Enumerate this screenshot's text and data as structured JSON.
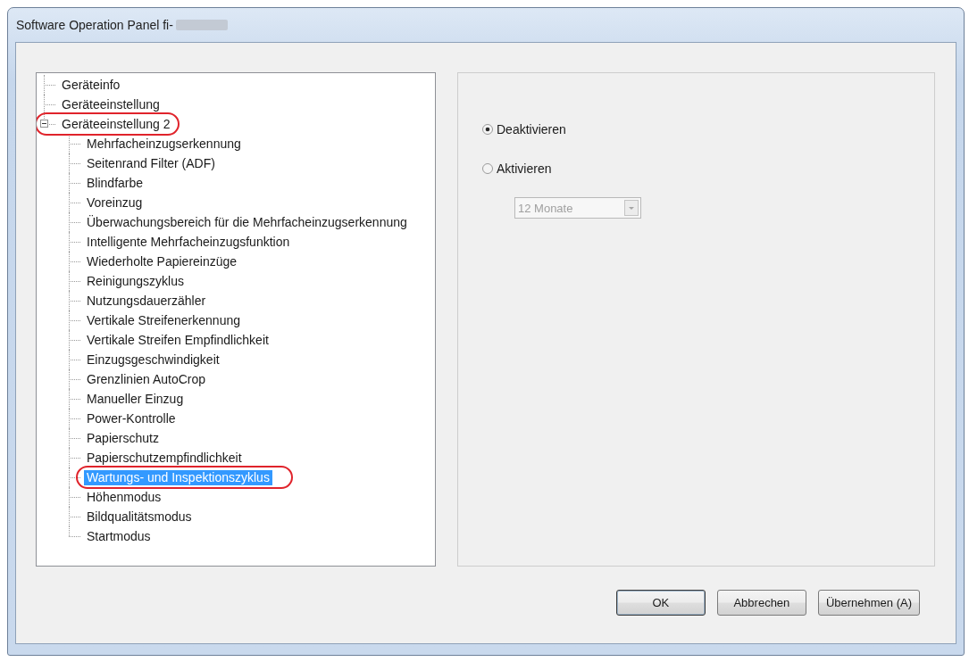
{
  "window": {
    "title": "Software Operation Panel fi-",
    "title_redacted": true
  },
  "tree": {
    "items": [
      {
        "label": "Geräteinfo",
        "selected": false,
        "circled": false
      },
      {
        "label": "Geräteeinstellung",
        "selected": false,
        "circled": false
      },
      {
        "label": "Geräteeinstellung 2",
        "selected": false,
        "circled": true,
        "expanded": true,
        "children": [
          {
            "label": "Mehrfacheinzugserkennung",
            "selected": false,
            "circled": false
          },
          {
            "label": "Seitenrand Filter (ADF)",
            "selected": false,
            "circled": false
          },
          {
            "label": "Blindfarbe",
            "selected": false,
            "circled": false
          },
          {
            "label": "Voreinzug",
            "selected": false,
            "circled": false
          },
          {
            "label": "Überwachungsbereich für die Mehrfacheinzugserkennung",
            "selected": false,
            "circled": false
          },
          {
            "label": "Intelligente Mehrfacheinzugsfunktion",
            "selected": false,
            "circled": false
          },
          {
            "label": "Wiederholte Papiereinzüge",
            "selected": false,
            "circled": false
          },
          {
            "label": "Reinigungszyklus",
            "selected": false,
            "circled": false
          },
          {
            "label": "Nutzungsdauerzähler",
            "selected": false,
            "circled": false
          },
          {
            "label": "Vertikale Streifenerkennung",
            "selected": false,
            "circled": false
          },
          {
            "label": "Vertikale Streifen Empfindlichkeit",
            "selected": false,
            "circled": false
          },
          {
            "label": "Einzugsgeschwindigkeit",
            "selected": false,
            "circled": false
          },
          {
            "label": "Grenzlinien AutoCrop",
            "selected": false,
            "circled": false
          },
          {
            "label": "Manueller Einzug",
            "selected": false,
            "circled": false
          },
          {
            "label": "Power-Kontrolle",
            "selected": false,
            "circled": false
          },
          {
            "label": "Papierschutz",
            "selected": false,
            "circled": false
          },
          {
            "label": "Papierschutzempfindlichkeit",
            "selected": false,
            "circled": false
          },
          {
            "label": "Wartungs- und Inspektionszyklus",
            "selected": true,
            "circled": true
          },
          {
            "label": "Höhenmodus",
            "selected": false,
            "circled": false
          },
          {
            "label": "Bildqualitätsmodus",
            "selected": false,
            "circled": false
          },
          {
            "label": "Startmodus",
            "selected": false,
            "circled": false
          }
        ]
      }
    ]
  },
  "settings": {
    "options": [
      {
        "label": "Deaktivieren",
        "selected": true
      },
      {
        "label": "Aktivieren",
        "selected": false
      }
    ],
    "dropdown": {
      "value": "12 Monate",
      "disabled": true
    }
  },
  "buttons": [
    {
      "label": "OK",
      "default": true
    },
    {
      "label": "Abbrechen",
      "default": false
    },
    {
      "label": "Übernehmen (A)",
      "default": false
    }
  ]
}
